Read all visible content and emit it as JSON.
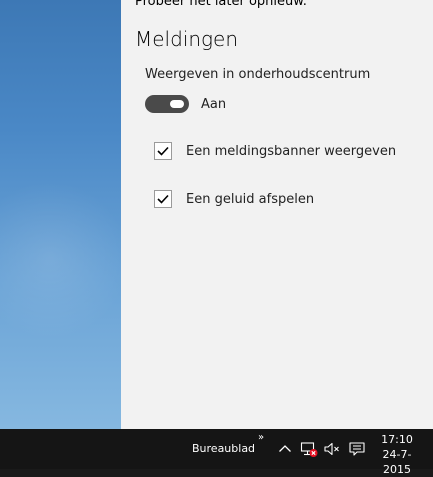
{
  "header": {
    "partial_text": "Probeer het later opnieuw."
  },
  "section": {
    "title": "Meldingen"
  },
  "setting": {
    "label": "Weergeven in onderhoudscentrum",
    "toggle_state": "Aan",
    "toggle_on": true,
    "options": [
      {
        "label": "Een meldingsbanner weergeven",
        "checked": true
      },
      {
        "label": "Een geluid afspelen",
        "checked": true
      }
    ]
  },
  "taskbar": {
    "desktop_label": "Bureaublad",
    "overflow_glyph": "»",
    "icons": [
      "chevron-up-icon",
      "network-error-icon",
      "volume-muted-icon",
      "action-center-icon"
    ],
    "time": "17:10",
    "date": "24-7-2015"
  },
  "colors": {
    "panel_bg": "#f2f2f2",
    "toggle_on": "#4a4a4a",
    "taskbar_bg": "#151515",
    "error_red": "#e81123"
  }
}
